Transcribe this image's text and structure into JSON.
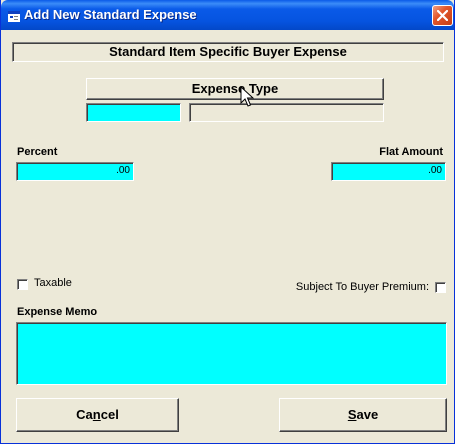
{
  "window": {
    "title": "Add New Standard Expense",
    "title_icon": "app-form-icon",
    "close_icon": "close-icon"
  },
  "header": {
    "text": "Standard Item Specific Buyer Expense"
  },
  "expense_type": {
    "button_label": "Expense Type",
    "code_value": "",
    "description_value": ""
  },
  "amounts": {
    "percent_label": "Percent",
    "percent_value": ".00",
    "flat_label": "Flat Amount",
    "flat_value": ".00"
  },
  "options": {
    "taxable_label": "Taxable",
    "taxable_checked": false,
    "buyer_premium_label": "Subject To Buyer Premium:",
    "buyer_premium_checked": false
  },
  "memo": {
    "label": "Expense Memo",
    "value": ""
  },
  "buttons": {
    "cancel_pre": "Ca",
    "cancel_key": "n",
    "cancel_post": "cel",
    "save_key": "S",
    "save_post": "ave"
  },
  "colors": {
    "field_highlight": "#00ffff",
    "titlebar": "#0a5ae8",
    "window_bg": "#ece9d8"
  }
}
